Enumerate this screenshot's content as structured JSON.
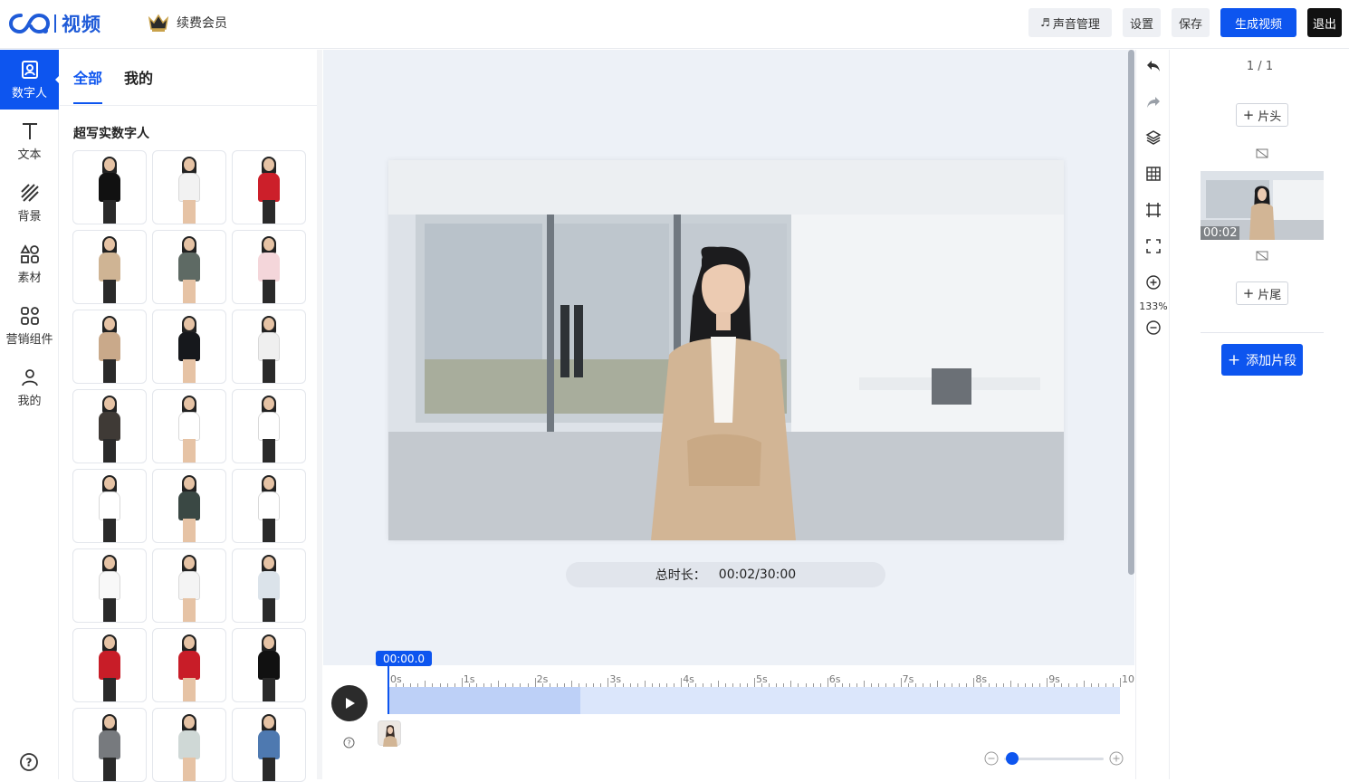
{
  "header": {
    "logo_text": "视频",
    "renew_label": "续费会员",
    "voice_label": "声音管理",
    "settings_label": "设置",
    "save_label": "保存",
    "generate_label": "生成视频",
    "exit_label": "退出"
  },
  "leftnav": {
    "items": [
      {
        "label": "数字人",
        "icon": "avatar-icon",
        "active": true
      },
      {
        "label": "文本",
        "icon": "text-icon"
      },
      {
        "label": "背景",
        "icon": "background-icon"
      },
      {
        "label": "素材",
        "icon": "material-icon"
      },
      {
        "label": "营销组件",
        "icon": "marketing-icon"
      },
      {
        "label": "我的",
        "icon": "user-icon"
      }
    ]
  },
  "panel": {
    "tabs": [
      "全部",
      "我的"
    ],
    "section_title": "超写实数字人",
    "avatar_colors": [
      "#111111",
      "#f2f2f2",
      "#cc1f2a",
      "#cfb494",
      "#5e6a64",
      "#f4d6da",
      "#c9a98a",
      "#16181c",
      "#efefef",
      "#3f3a36",
      "#ffffff",
      "#ffffff",
      "#ffffff",
      "#3a4844",
      "#ffffff",
      "#f8f8f8",
      "#f4f4f4",
      "#dbe3ea",
      "#c81d28",
      "#c81d28",
      "#111111",
      "#777a7e",
      "#cfd8d6",
      "#4e79b0"
    ]
  },
  "canvas": {
    "duration_label": "总时长：",
    "duration_value": "00:02/30:00"
  },
  "tools": {
    "zoom": "133%"
  },
  "rightpanel": {
    "page_indicator": "1 / 1",
    "head_label": "片头",
    "tail_label": "片尾",
    "scene_time": "00:02",
    "add_segment_label": "添加片段"
  },
  "timeline": {
    "playhead_time": "00:00.0",
    "ticks": [
      "0s",
      "1s",
      "2s",
      "3s",
      "4s",
      "5s",
      "6s",
      "7s",
      "8s",
      "9s",
      "10"
    ],
    "clip_fraction": 0.262
  }
}
